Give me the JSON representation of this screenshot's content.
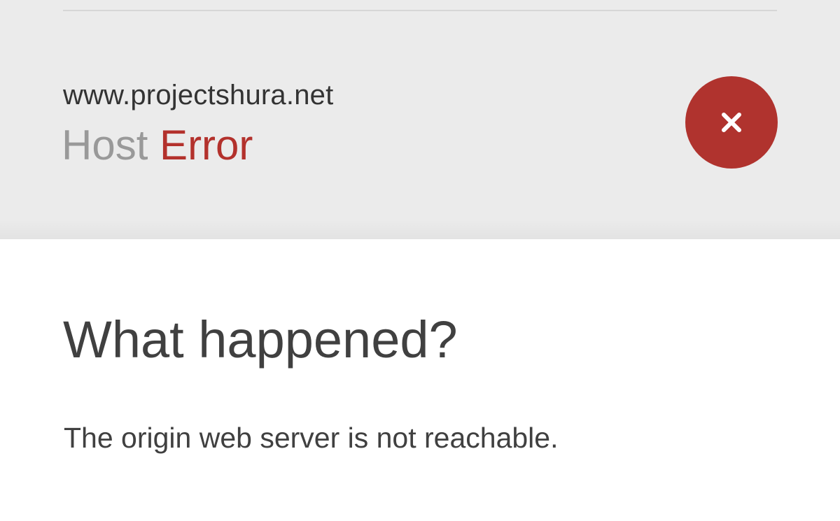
{
  "status": {
    "host": "www.projectshura.net",
    "label": "Host",
    "value": "Error",
    "error_color": "#b0332e",
    "icon": "close-icon"
  },
  "main": {
    "heading": "What happened?",
    "message": "The origin web server is not reachable."
  }
}
